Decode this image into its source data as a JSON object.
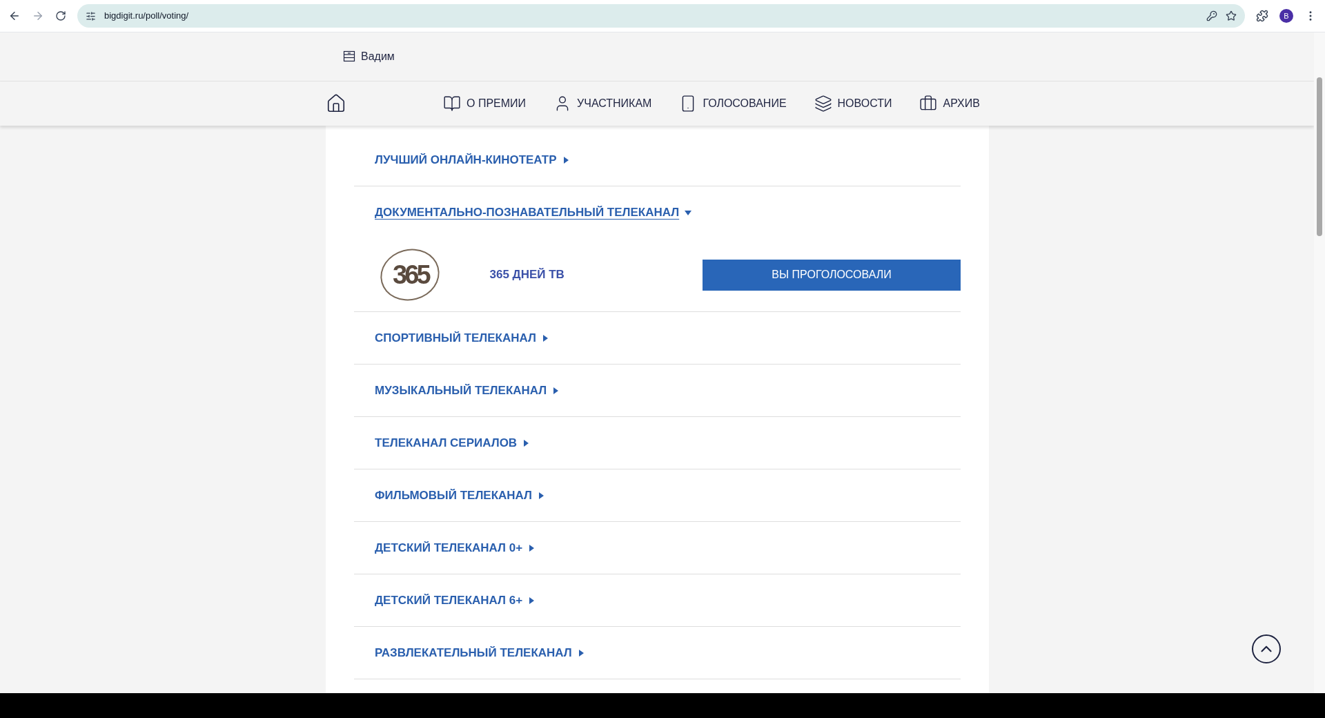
{
  "browser": {
    "url": "bigdigit.ru/poll/voting/",
    "profile_initial": "B"
  },
  "user": {
    "name": "Вадим"
  },
  "nav": [
    {
      "kind": "home"
    },
    {
      "kind": "book",
      "label": "О ПРЕМИИ"
    },
    {
      "kind": "person",
      "label": "УЧАСТНИКАМ"
    },
    {
      "kind": "remote",
      "label": "ГОЛОСОВАНИЕ"
    },
    {
      "kind": "news",
      "label": "НОВОСТИ"
    },
    {
      "kind": "archive",
      "label": "АРХИВ"
    }
  ],
  "categories": [
    {
      "title": "ЛУЧШИЙ ОНЛАЙН-КИНОТЕАТР",
      "expanded": false
    },
    {
      "title": "ДОКУМЕНТАЛЬНО-ПОЗНАВАТЕЛЬНЫЙ ТЕЛЕКАНАЛ",
      "expanded": true,
      "nominees": [
        {
          "logo": "365",
          "name": "365 ДНЕЙ ТВ",
          "button": "ВЫ ПРОГОЛОСОВАЛИ"
        }
      ]
    },
    {
      "title": "СПОРТИВНЫЙ ТЕЛЕКАНАЛ",
      "expanded": false
    },
    {
      "title": "МУЗЫКАЛЬНЫЙ ТЕЛЕКАНАЛ",
      "expanded": false
    },
    {
      "title": "ТЕЛЕКАНАЛ СЕРИАЛОВ",
      "expanded": false
    },
    {
      "title": "ФИЛЬМОВЫЙ ТЕЛЕКАНАЛ",
      "expanded": false
    },
    {
      "title": "ДЕТСКИЙ ТЕЛЕКАНАЛ 0+",
      "expanded": false
    },
    {
      "title": "ДЕТСКИЙ ТЕЛЕКАНАЛ 6+",
      "expanded": false
    },
    {
      "title": "РАЗВЛЕКАТЕЛЬНЫЙ ТЕЛЕКАНАЛ",
      "expanded": false
    }
  ]
}
